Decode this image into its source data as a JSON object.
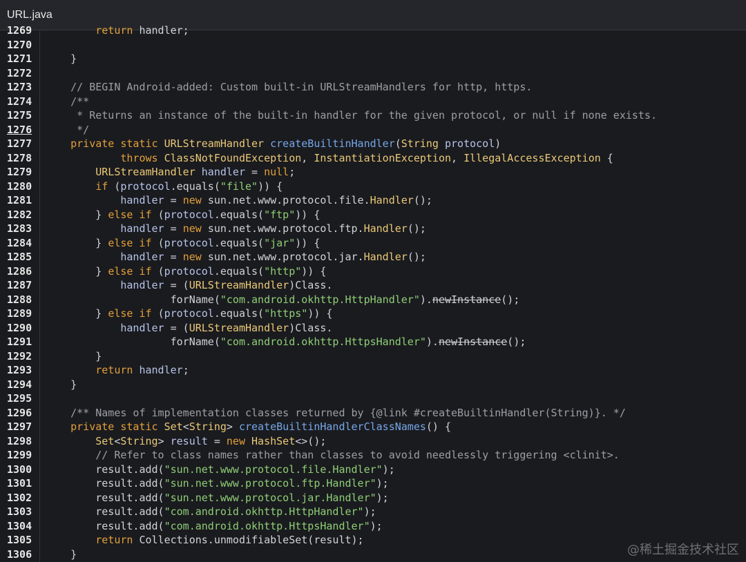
{
  "window": {
    "title": "URL.java"
  },
  "current_line": 1276,
  "colors": {
    "background": "#1a1b1f",
    "keyword": "#e3a03a",
    "type": "#ebc977",
    "method": "#76a7e8",
    "string": "#8fce76",
    "comment": "#9aa0a6",
    "variable": "#b7c4e8"
  },
  "lines": [
    {
      "n": "1269",
      "t": [
        [
          "keyword",
          "        return "
        ],
        [
          "plain",
          "handler;"
        ]
      ]
    },
    {
      "n": "1270",
      "t": []
    },
    {
      "n": "1271",
      "t": [
        [
          "plain",
          "    }"
        ]
      ]
    },
    {
      "n": "1272",
      "t": []
    },
    {
      "n": "1273",
      "t": [
        [
          "comment",
          "    // BEGIN Android-added: Custom built-in URLStreamHandlers for http, https."
        ]
      ]
    },
    {
      "n": "1274",
      "t": [
        [
          "comment",
          "    /**"
        ]
      ]
    },
    {
      "n": "1275",
      "t": [
        [
          "comment",
          "     * Returns an instance of the built-in handler for the given protocol, or null if none exists."
        ]
      ]
    },
    {
      "n": "1276",
      "t": [
        [
          "comment",
          "     */"
        ]
      ]
    },
    {
      "n": "1277",
      "t": [
        [
          "keyword",
          "    private static "
        ],
        [
          "type",
          "URLStreamHandler "
        ],
        [
          "method",
          "createBuiltinHandler"
        ],
        [
          "plain",
          "("
        ],
        [
          "type",
          "String "
        ],
        [
          "var",
          "protocol"
        ],
        [
          "plain",
          ")"
        ]
      ]
    },
    {
      "n": "1278",
      "t": [
        [
          "keyword",
          "            throws "
        ],
        [
          "type",
          "ClassNotFoundException"
        ],
        [
          "plain",
          ", "
        ],
        [
          "type",
          "InstantiationException"
        ],
        [
          "plain",
          ", "
        ],
        [
          "type",
          "IllegalAccessException"
        ],
        [
          "plain",
          " {"
        ]
      ]
    },
    {
      "n": "1279",
      "t": [
        [
          "type",
          "        URLStreamHandler "
        ],
        [
          "var",
          "handler"
        ],
        [
          "plain",
          " = "
        ],
        [
          "keyword",
          "null"
        ],
        [
          "plain",
          ";"
        ]
      ]
    },
    {
      "n": "1280",
      "t": [
        [
          "keyword",
          "        if "
        ],
        [
          "plain",
          "("
        ],
        [
          "var",
          "protocol"
        ],
        [
          "plain",
          ".equals("
        ],
        [
          "string",
          "\"file\""
        ],
        [
          "plain",
          ")) {"
        ]
      ]
    },
    {
      "n": "1281",
      "t": [
        [
          "var",
          "            handler"
        ],
        [
          "plain",
          " = "
        ],
        [
          "keyword",
          "new "
        ],
        [
          "plain",
          "sun.net.www.protocol.file."
        ],
        [
          "type",
          "Handler"
        ],
        [
          "plain",
          "();"
        ]
      ]
    },
    {
      "n": "1282",
      "t": [
        [
          "plain",
          "        } "
        ],
        [
          "keyword",
          "else if "
        ],
        [
          "plain",
          "("
        ],
        [
          "var",
          "protocol"
        ],
        [
          "plain",
          ".equals("
        ],
        [
          "string",
          "\"ftp\""
        ],
        [
          "plain",
          ")) {"
        ]
      ]
    },
    {
      "n": "1283",
      "t": [
        [
          "var",
          "            handler"
        ],
        [
          "plain",
          " = "
        ],
        [
          "keyword",
          "new "
        ],
        [
          "plain",
          "sun.net.www.protocol.ftp."
        ],
        [
          "type",
          "Handler"
        ],
        [
          "plain",
          "();"
        ]
      ]
    },
    {
      "n": "1284",
      "t": [
        [
          "plain",
          "        } "
        ],
        [
          "keyword",
          "else if "
        ],
        [
          "plain",
          "("
        ],
        [
          "var",
          "protocol"
        ],
        [
          "plain",
          ".equals("
        ],
        [
          "string",
          "\"jar\""
        ],
        [
          "plain",
          ")) {"
        ]
      ]
    },
    {
      "n": "1285",
      "t": [
        [
          "var",
          "            handler"
        ],
        [
          "plain",
          " = "
        ],
        [
          "keyword",
          "new "
        ],
        [
          "plain",
          "sun.net.www.protocol.jar."
        ],
        [
          "type",
          "Handler"
        ],
        [
          "plain",
          "();"
        ]
      ]
    },
    {
      "n": "1286",
      "t": [
        [
          "plain",
          "        } "
        ],
        [
          "keyword",
          "else if "
        ],
        [
          "plain",
          "("
        ],
        [
          "var",
          "protocol"
        ],
        [
          "plain",
          ".equals("
        ],
        [
          "string",
          "\"http\""
        ],
        [
          "plain",
          ")) {"
        ]
      ]
    },
    {
      "n": "1287",
      "t": [
        [
          "var",
          "            handler"
        ],
        [
          "plain",
          " = ("
        ],
        [
          "type",
          "URLStreamHandler"
        ],
        [
          "plain",
          ")Class."
        ]
      ]
    },
    {
      "n": "1288",
      "t": [
        [
          "plain",
          "                    forName("
        ],
        [
          "string",
          "\"com.android.okhttp.HttpHandler\""
        ],
        [
          "plain",
          ")."
        ],
        [
          "deprecated",
          "newInstance"
        ],
        [
          "plain",
          "();"
        ]
      ]
    },
    {
      "n": "1289",
      "t": [
        [
          "plain",
          "        } "
        ],
        [
          "keyword",
          "else if "
        ],
        [
          "plain",
          "("
        ],
        [
          "var",
          "protocol"
        ],
        [
          "plain",
          ".equals("
        ],
        [
          "string",
          "\"https\""
        ],
        [
          "plain",
          ")) {"
        ]
      ]
    },
    {
      "n": "1290",
      "t": [
        [
          "var",
          "            handler"
        ],
        [
          "plain",
          " = ("
        ],
        [
          "type",
          "URLStreamHandler"
        ],
        [
          "plain",
          ")Class."
        ]
      ]
    },
    {
      "n": "1291",
      "t": [
        [
          "plain",
          "                    forName("
        ],
        [
          "string",
          "\"com.android.okhttp.HttpsHandler\""
        ],
        [
          "plain",
          ")."
        ],
        [
          "deprecated",
          "newInstance"
        ],
        [
          "plain",
          "();"
        ]
      ]
    },
    {
      "n": "1292",
      "t": [
        [
          "plain",
          "        }"
        ]
      ]
    },
    {
      "n": "1293",
      "t": [
        [
          "keyword",
          "        return "
        ],
        [
          "var",
          "handler"
        ],
        [
          "plain",
          ";"
        ]
      ]
    },
    {
      "n": "1294",
      "t": [
        [
          "plain",
          "    }"
        ]
      ]
    },
    {
      "n": "1295",
      "t": []
    },
    {
      "n": "1296",
      "t": [
        [
          "comment",
          "    /** Names of implementation classes returned by {@link #createBuiltinHandler(String)}. */"
        ]
      ]
    },
    {
      "n": "1297",
      "t": [
        [
          "keyword",
          "    private static "
        ],
        [
          "type",
          "Set"
        ],
        [
          "plain",
          "<"
        ],
        [
          "type",
          "String"
        ],
        [
          "plain",
          "> "
        ],
        [
          "method",
          "createBuiltinHandlerClassNames"
        ],
        [
          "plain",
          "() {"
        ]
      ]
    },
    {
      "n": "1298",
      "t": [
        [
          "type",
          "        Set"
        ],
        [
          "plain",
          "<"
        ],
        [
          "type",
          "String"
        ],
        [
          "plain",
          "> "
        ],
        [
          "var",
          "result"
        ],
        [
          "plain",
          " = "
        ],
        [
          "keyword",
          "new "
        ],
        [
          "type",
          "HashSet"
        ],
        [
          "plain",
          "<>();"
        ]
      ]
    },
    {
      "n": "1299",
      "t": [
        [
          "comment",
          "        // Refer to class names rather than classes to avoid needlessly triggering <clinit>."
        ]
      ]
    },
    {
      "n": "1300",
      "t": [
        [
          "plain",
          "        result.add("
        ],
        [
          "string",
          "\"sun.net.www.protocol.file.Handler\""
        ],
        [
          "plain",
          ");"
        ]
      ]
    },
    {
      "n": "1301",
      "t": [
        [
          "plain",
          "        result.add("
        ],
        [
          "string",
          "\"sun.net.www.protocol.ftp.Handler\""
        ],
        [
          "plain",
          ");"
        ]
      ]
    },
    {
      "n": "1302",
      "t": [
        [
          "plain",
          "        result.add("
        ],
        [
          "string",
          "\"sun.net.www.protocol.jar.Handler\""
        ],
        [
          "plain",
          ");"
        ]
      ]
    },
    {
      "n": "1303",
      "t": [
        [
          "plain",
          "        result.add("
        ],
        [
          "string",
          "\"com.android.okhttp.HttpHandler\""
        ],
        [
          "plain",
          ");"
        ]
      ]
    },
    {
      "n": "1304",
      "t": [
        [
          "plain",
          "        result.add("
        ],
        [
          "string",
          "\"com.android.okhttp.HttpsHandler\""
        ],
        [
          "plain",
          ");"
        ]
      ]
    },
    {
      "n": "1305",
      "t": [
        [
          "keyword",
          "        return "
        ],
        [
          "plain",
          "Collections.unmodifiableSet(result);"
        ]
      ]
    },
    {
      "n": "1306",
      "t": [
        [
          "plain",
          "    }"
        ]
      ]
    }
  ],
  "watermark": "@稀土掘金技术社区"
}
